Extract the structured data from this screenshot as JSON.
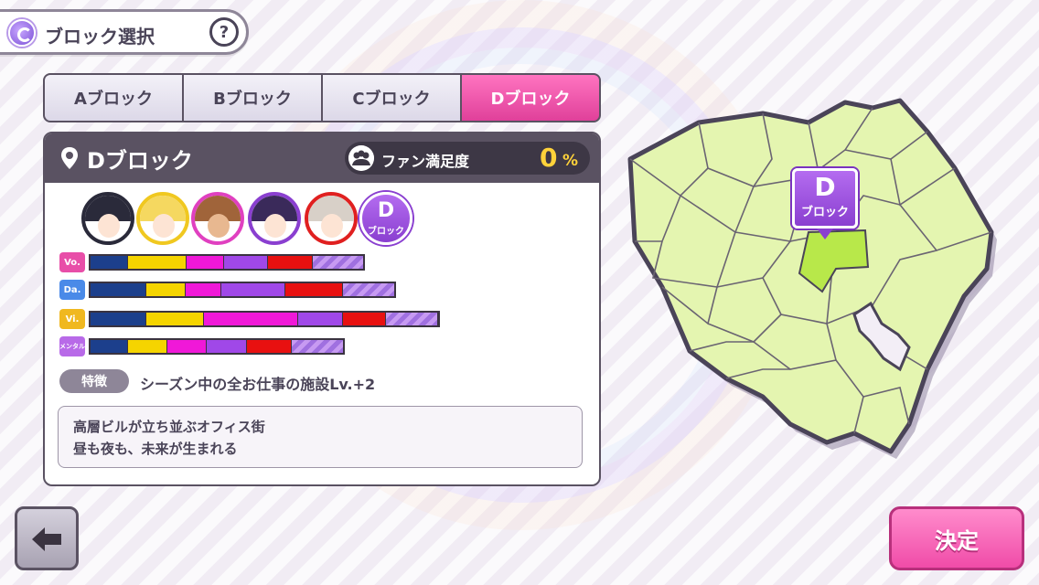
{
  "header": {
    "title": "ブロック選択",
    "help_label": "?"
  },
  "tabs": [
    {
      "label": "Aブロック",
      "active": false
    },
    {
      "label": "Bブロック",
      "active": false
    },
    {
      "label": "Cブロック",
      "active": false
    },
    {
      "label": "Dブロック",
      "active": true
    }
  ],
  "panel": {
    "title": "Dブロック",
    "fan_label": "ファン満足度",
    "fan_value": "0",
    "fan_unit": "%",
    "badge_letter": "D",
    "badge_sub": "ブロック",
    "stats": [
      {
        "icon_label": "Vo.",
        "icon_color": "#e84ea8"
      },
      {
        "icon_label": "Da.",
        "icon_color": "#4a8ae8"
      },
      {
        "icon_label": "Vi.",
        "icon_color": "#f0b820"
      },
      {
        "icon_label": "メンタル",
        "icon_color": "#b86ae8"
      }
    ],
    "feature_tag": "特徴",
    "feature_text": "シーズン中の全お仕事の施設Lv.+2",
    "description_lines": [
      "高層ビルが立ち並ぶオフィス街",
      "昼も夜も、未来が生まれる"
    ]
  },
  "map": {
    "marker_letter": "D",
    "marker_sub": "ブロック"
  },
  "buttons": {
    "confirm_label": "決定"
  }
}
